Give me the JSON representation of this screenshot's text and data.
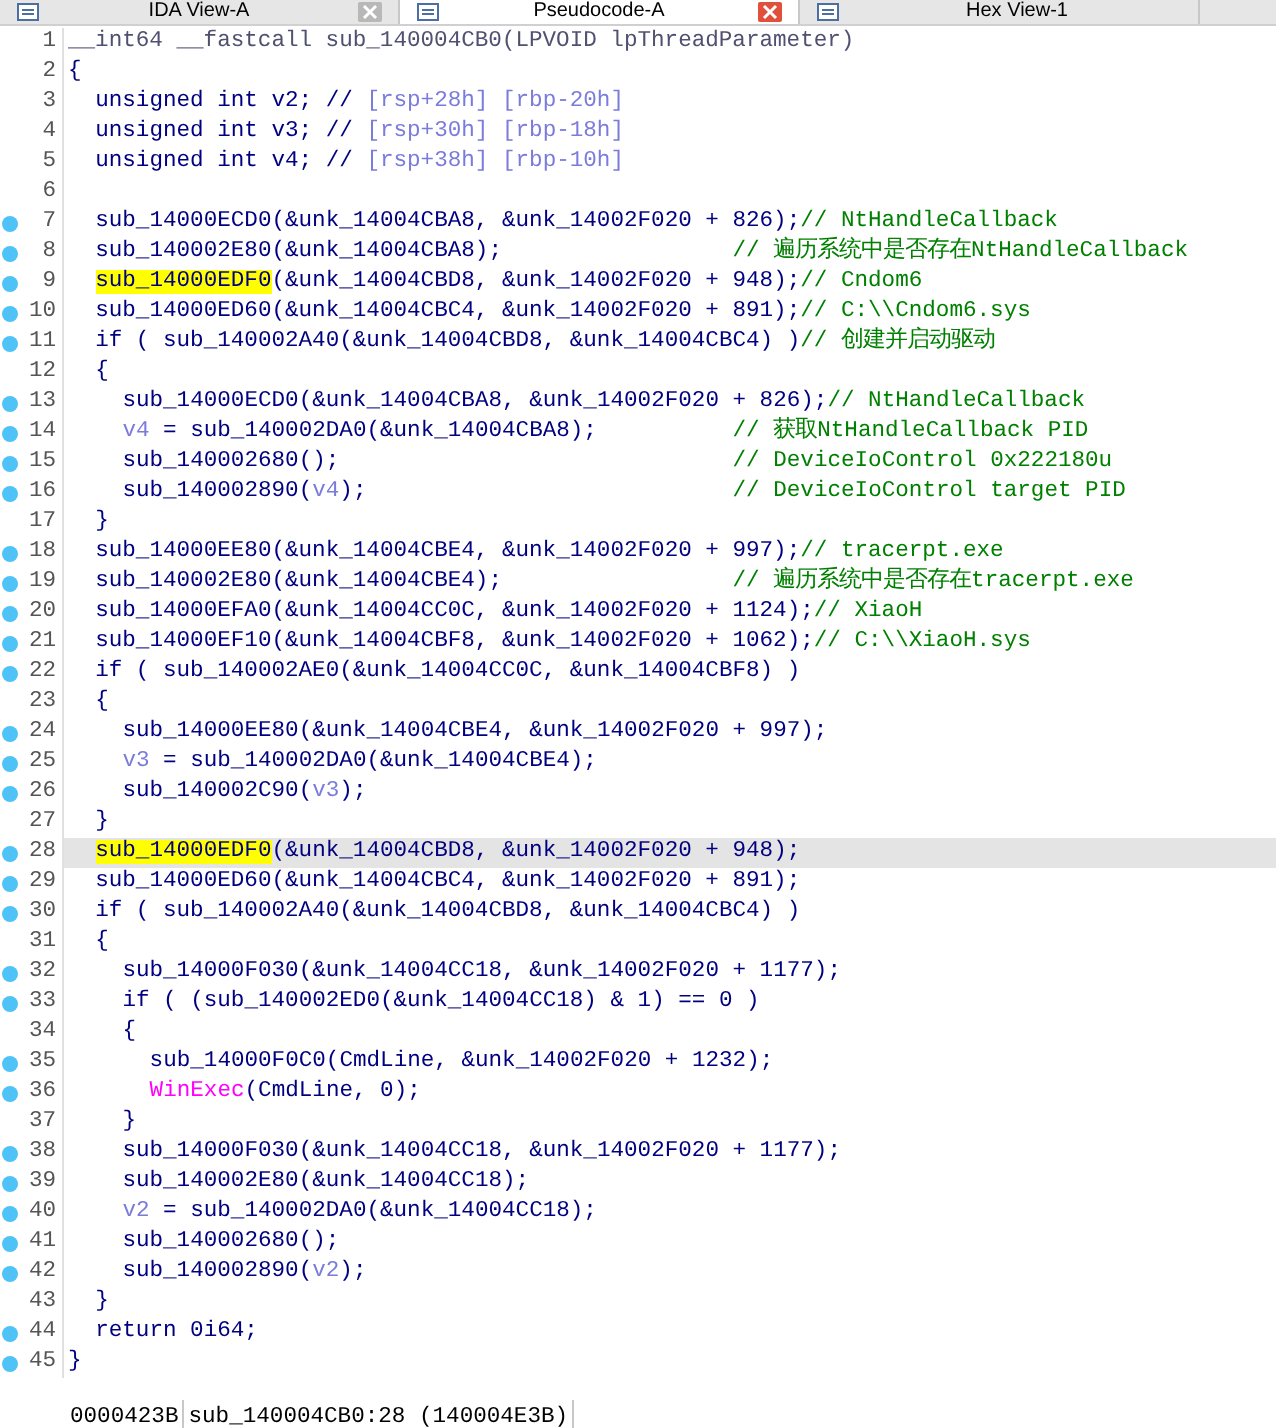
{
  "tabs": [
    {
      "label": "IDA View-A",
      "selected": false,
      "closable": true
    },
    {
      "label": "Pseudocode-A",
      "selected": true,
      "closable": true
    },
    {
      "label": "Hex View-1",
      "selected": false,
      "closable": false
    }
  ],
  "lines": [
    {
      "num": "1",
      "dot": false,
      "current": false,
      "tokens": [
        {
          "kind": "dim",
          "text": "__int64 __fastcall sub_140004CB0(LPVOID lpThreadParameter)"
        }
      ]
    },
    {
      "num": "2",
      "dot": false,
      "current": false,
      "tokens": [
        {
          "kind": "code",
          "text": "{"
        }
      ],
      "children": [
        {
          "num": "3",
          "dot": false,
          "current": false,
          "tokens": [
            {
              "kind": "code",
              "text": "unsigned int v2; // "
            },
            {
              "kind": "var",
              "text": "[rsp+28h] [rbp-20h]"
            }
          ]
        },
        {
          "num": "4",
          "dot": false,
          "current": false,
          "tokens": [
            {
              "kind": "code",
              "text": "unsigned int v3; // "
            },
            {
              "kind": "var",
              "text": "[rsp+30h] [rbp-18h]"
            }
          ]
        },
        {
          "num": "5",
          "dot": false,
          "current": false,
          "tokens": [
            {
              "kind": "code",
              "text": "unsigned int v4; // "
            },
            {
              "kind": "var",
              "text": "[rsp+38h] [rbp-10h]"
            }
          ]
        },
        {
          "num": "6",
          "dot": false,
          "current": false
        },
        {
          "num": "7",
          "dot": true,
          "current": false,
          "tokens": [
            {
              "kind": "code",
              "text": "sub_14000ECD0(&unk_14004CBA8, &unk_14002F020 + 826);"
            },
            {
              "kind": "comment",
              "text": "// NtHandleCallback"
            }
          ]
        },
        {
          "num": "8",
          "dot": true,
          "current": false,
          "tokens": [
            {
              "kind": "code",
              "text": "sub_140002E80(&unk_14004CBA8);                 "
            },
            {
              "kind": "comment",
              "text": "// 遍历系统中是否存在NtHandleCallback"
            }
          ]
        },
        {
          "num": "9",
          "dot": true,
          "current": false,
          "tokens": [
            {
              "kind": "highlight",
              "text": "sub_14000EDF0"
            },
            {
              "kind": "code",
              "text": "(&unk_14004CBD8, &unk_14002F020 + 948);"
            },
            {
              "kind": "comment",
              "text": "// Cndom6"
            }
          ]
        },
        {
          "num": "10",
          "dot": true,
          "current": false,
          "tokens": [
            {
              "kind": "code",
              "text": "sub_14000ED60(&unk_14004CBC4, &unk_14002F020 + 891);"
            },
            {
              "kind": "comment",
              "text": "// C:\\\\Cndom6.sys"
            }
          ]
        },
        {
          "num": "11",
          "dot": true,
          "current": false,
          "tokens": [
            {
              "kind": "code",
              "text": "if ( sub_140002A40(&unk_14004CBD8, &unk_14004CBC4) )"
            },
            {
              "kind": "comment",
              "text": "// 创建并启动驱动"
            }
          ]
        },
        {
          "num": "12",
          "dot": false,
          "current": false,
          "tokens": [
            {
              "kind": "code",
              "text": "{"
            }
          ],
          "children": [
            {
              "num": "13",
              "dot": true,
              "current": false,
              "tokens": [
                {
                  "kind": "code",
                  "text": "sub_14000ECD0(&unk_14004CBA8, &unk_14002F020 + 826);"
                },
                {
                  "kind": "comment",
                  "text": "// NtHandleCallback"
                }
              ]
            },
            {
              "num": "14",
              "dot": true,
              "current": false,
              "tokens": [
                {
                  "kind": "var",
                  "text": "v4"
                },
                {
                  "kind": "code",
                  "text": " = sub_140002DA0(&unk_14004CBA8);          "
                },
                {
                  "kind": "comment",
                  "text": "// 获取NtHandleCallback PID"
                }
              ]
            },
            {
              "num": "15",
              "dot": true,
              "current": false,
              "tokens": [
                {
                  "kind": "code",
                  "text": "sub_140002680();                             "
                },
                {
                  "kind": "comment",
                  "text": "// DeviceIoControl 0x222180u"
                }
              ]
            },
            {
              "num": "16",
              "dot": true,
              "current": false,
              "tokens": [
                {
                  "kind": "code",
                  "text": "sub_140002890("
                },
                {
                  "kind": "var",
                  "text": "v4"
                },
                {
                  "kind": "code",
                  "text": ");                           "
                },
                {
                  "kind": "comment",
                  "text": "// DeviceIoControl target PID"
                }
              ]
            }
          ]
        },
        {
          "num": "17",
          "dot": false,
          "current": false,
          "tokens": [
            {
              "kind": "code",
              "text": "}"
            }
          ]
        },
        {
          "num": "18",
          "dot": true,
          "current": false,
          "tokens": [
            {
              "kind": "code",
              "text": "sub_14000EE80(&unk_14004CBE4, &unk_14002F020 + 997);"
            },
            {
              "kind": "comment",
              "text": "// tracerpt.exe"
            }
          ]
        },
        {
          "num": "19",
          "dot": true,
          "current": false,
          "tokens": [
            {
              "kind": "code",
              "text": "sub_140002E80(&unk_14004CBE4);                 "
            },
            {
              "kind": "comment",
              "text": "// 遍历系统中是否存在tracerpt.exe"
            }
          ]
        },
        {
          "num": "20",
          "dot": true,
          "current": false,
          "tokens": [
            {
              "kind": "code",
              "text": "sub_14000EFA0(&unk_14004CC0C, &unk_14002F020 + 1124);"
            },
            {
              "kind": "comment",
              "text": "// XiaoH"
            }
          ]
        },
        {
          "num": "21",
          "dot": true,
          "current": false,
          "tokens": [
            {
              "kind": "code",
              "text": "sub_14000EF10(&unk_14004CBF8, &unk_14002F020 + 1062);"
            },
            {
              "kind": "comment",
              "text": "// C:\\\\XiaoH.sys"
            }
          ]
        },
        {
          "num": "22",
          "dot": true,
          "current": false,
          "tokens": [
            {
              "kind": "code",
              "text": "if ( sub_140002AE0(&unk_14004CC0C, &unk_14004CBF8) )"
            }
          ]
        },
        {
          "num": "23",
          "dot": false,
          "current": false,
          "tokens": [
            {
              "kind": "code",
              "text": "{"
            }
          ],
          "children": [
            {
              "num": "24",
              "dot": true,
              "current": false,
              "tokens": [
                {
                  "kind": "code",
                  "text": "sub_14000EE80(&unk_14004CBE4, &unk_14002F020 + 997);"
                }
              ]
            },
            {
              "num": "25",
              "dot": true,
              "current": false,
              "tokens": [
                {
                  "kind": "var",
                  "text": "v3"
                },
                {
                  "kind": "code",
                  "text": " = sub_140002DA0(&unk_14004CBE4);"
                }
              ]
            },
            {
              "num": "26",
              "dot": true,
              "current": false,
              "tokens": [
                {
                  "kind": "code",
                  "text": "sub_140002C90("
                },
                {
                  "kind": "var",
                  "text": "v3"
                },
                {
                  "kind": "code",
                  "text": ");"
                }
              ]
            }
          ]
        },
        {
          "num": "27",
          "dot": false,
          "current": false,
          "tokens": [
            {
              "kind": "code",
              "text": "}"
            }
          ]
        },
        {
          "num": "28",
          "dot": true,
          "current": true,
          "tokens": [
            {
              "kind": "highlight",
              "text": "sub_14000EDF0"
            },
            {
              "kind": "code",
              "text": "(&unk_14004CBD8, &unk_14002F020 + 948);"
            }
          ]
        },
        {
          "num": "29",
          "dot": true,
          "current": false,
          "tokens": [
            {
              "kind": "code",
              "text": "sub_14000ED60(&unk_14004CBC4, &unk_14002F020 + 891);"
            }
          ]
        },
        {
          "num": "30",
          "dot": true,
          "current": false,
          "tokens": [
            {
              "kind": "code",
              "text": "if ( sub_140002A40(&unk_14004CBD8, &unk_14004CBC4) )"
            }
          ]
        },
        {
          "num": "31",
          "dot": false,
          "current": false,
          "tokens": [
            {
              "kind": "code",
              "text": "{"
            }
          ],
          "children": [
            {
              "num": "32",
              "dot": true,
              "current": false,
              "tokens": [
                {
                  "kind": "code",
                  "text": "sub_14000F030(&unk_14004CC18, &unk_14002F020 + 1177);"
                }
              ]
            },
            {
              "num": "33",
              "dot": true,
              "current": false,
              "tokens": [
                {
                  "kind": "code",
                  "text": "if ( (sub_140002ED0(&unk_14004CC18) & 1) == 0 )"
                }
              ]
            },
            {
              "num": "34",
              "dot": false,
              "current": false,
              "tokens": [
                {
                  "kind": "code",
                  "text": "{"
                }
              ],
              "children": [
                {
                  "num": "35",
                  "dot": true,
                  "current": false,
                  "tokens": [
                    {
                      "kind": "code",
                      "text": "sub_14000F0C0(CmdLine, &unk_14002F020 + 1232);"
                    }
                  ]
                },
                {
                  "num": "36",
                  "dot": true,
                  "current": false,
                  "tokens": [
                    {
                      "kind": "api",
                      "text": "WinExec"
                    },
                    {
                      "kind": "code",
                      "text": "(CmdLine, 0);"
                    }
                  ]
                }
              ]
            },
            {
              "num": "37",
              "dot": false,
              "current": false,
              "tokens": [
                {
                  "kind": "code",
                  "text": "}"
                }
              ]
            },
            {
              "num": "38",
              "dot": true,
              "current": false,
              "tokens": [
                {
                  "kind": "code",
                  "text": "sub_14000F030(&unk_14004CC18, &unk_14002F020 + 1177);"
                }
              ]
            },
            {
              "num": "39",
              "dot": true,
              "current": false,
              "tokens": [
                {
                  "kind": "code",
                  "text": "sub_140002E80(&unk_14004CC18);"
                }
              ]
            },
            {
              "num": "40",
              "dot": true,
              "current": false,
              "tokens": [
                {
                  "kind": "var",
                  "text": "v2"
                },
                {
                  "kind": "code",
                  "text": " = sub_140002DA0(&unk_14004CC18);"
                }
              ]
            },
            {
              "num": "41",
              "dot": true,
              "current": false,
              "tokens": [
                {
                  "kind": "code",
                  "text": "sub_140002680();"
                }
              ]
            },
            {
              "num": "42",
              "dot": true,
              "current": false,
              "tokens": [
                {
                  "kind": "code",
                  "text": "sub_140002890("
                },
                {
                  "kind": "var",
                  "text": "v2"
                },
                {
                  "kind": "code",
                  "text": ");"
                }
              ]
            }
          ]
        },
        {
          "num": "43",
          "dot": false,
          "current": false,
          "tokens": [
            {
              "kind": "code",
              "text": "}"
            }
          ]
        },
        {
          "num": "44",
          "dot": true,
          "current": false,
          "tokens": [
            {
              "kind": "code",
              "text": "return 0i64;"
            }
          ]
        }
      ]
    },
    {
      "num": "45",
      "dot": true,
      "current": false,
      "tokens": [
        {
          "kind": "code",
          "text": "}"
        }
      ]
    }
  ],
  "status_bar": {
    "offset": "0000423B",
    "location": "sub_140004CB0:28 (140004E3B)"
  }
}
